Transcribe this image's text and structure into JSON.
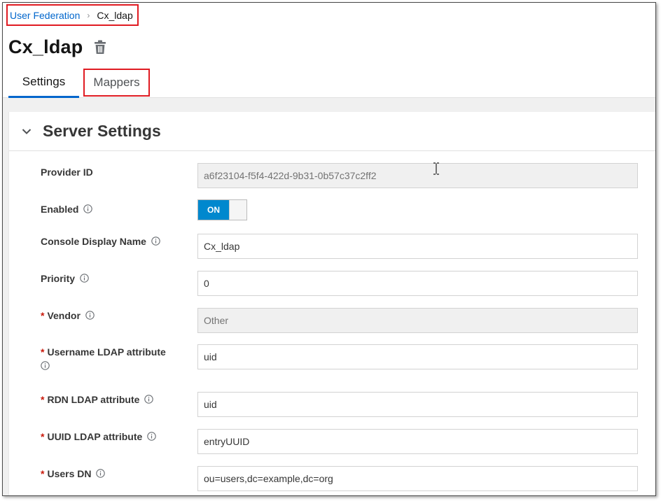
{
  "breadcrumb": {
    "parent": "User Federation",
    "separator": "›",
    "current": "Cx_ldap"
  },
  "page": {
    "title": "Cx_ldap"
  },
  "tabs": [
    {
      "label": "Settings",
      "active": true
    },
    {
      "label": "Mappers",
      "active": false
    }
  ],
  "section": {
    "title": "Server Settings"
  },
  "form": {
    "provider_id": {
      "label": "Provider ID",
      "value": "a6f23104-f5f4-422d-9b31-0b57c37c2ff2"
    },
    "enabled": {
      "label": "Enabled",
      "value": "ON"
    },
    "console_display_name": {
      "label": "Console Display Name",
      "value": "Cx_ldap"
    },
    "priority": {
      "label": "Priority",
      "value": "0"
    },
    "vendor": {
      "label": "Vendor",
      "value": "Other"
    },
    "username_ldap_attribute": {
      "label": "Username LDAP attribute",
      "value": "uid"
    },
    "rdn_ldap_attribute": {
      "label": "RDN LDAP attribute",
      "value": "uid"
    },
    "uuid_ldap_attribute": {
      "label": "UUID LDAP attribute",
      "value": "entryUUID"
    },
    "users_dn": {
      "label": "Users DN",
      "value": "ou=users,dc=example,dc=org"
    }
  },
  "required_marker": "*",
  "colors": {
    "link": "#0066cc",
    "tab_active_underline": "#0066cc",
    "toggle_on": "#0088ce",
    "required": "#c9190b",
    "highlight_box": "#e01b22"
  },
  "icons": {
    "delete": "trash-icon",
    "collapse": "chevron-down-icon",
    "help": "info-icon",
    "pointer": "text-cursor-icon"
  }
}
